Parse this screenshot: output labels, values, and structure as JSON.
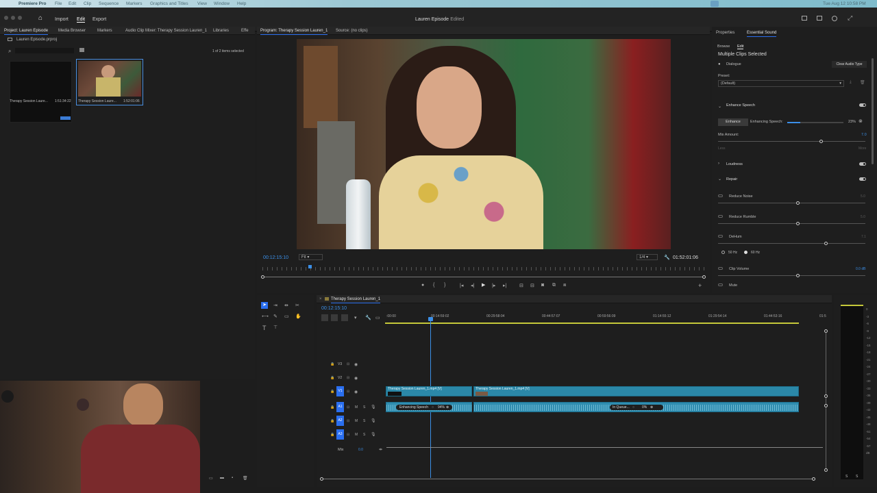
{
  "os_bar": {
    "app": "Premiere Pro",
    "menus": [
      "File",
      "Edit",
      "Clip",
      "Sequence",
      "Markers",
      "Graphics and Titles",
      "View",
      "Window",
      "Help"
    ],
    "clock": "Tue Aug 12  10:58 PM"
  },
  "header": {
    "nav": {
      "import": "Import",
      "edit": "Edit",
      "export": "Export"
    },
    "title": "Lauren Episode",
    "title_status": "- Edited"
  },
  "project": {
    "tabs": [
      "Project: Lauren Episode",
      "Media Browser",
      "Markers",
      "Audio Clip Mixer: Therapy Session Lauren_1",
      "Libraries",
      "Effe"
    ],
    "file": "Lauren Episode.prproj",
    "count": "1 of 2 items selected",
    "items": [
      {
        "name": "Therapy Session Laure...",
        "dur": "1:51:34:22"
      },
      {
        "name": "Therapy Session Laure...",
        "dur": "1:52:01:06"
      }
    ]
  },
  "program": {
    "tab": "Program: Therapy Session Lauren_1",
    "source_tab": "Source: (no clips)",
    "timecode": "00:12:15:10",
    "fit": "Fit",
    "res": "1/4",
    "duration": "01:52:01:06"
  },
  "essential_sound": {
    "tabs": [
      "Properties",
      "Essential Sound"
    ],
    "subtabs": [
      "Browse",
      "Edit"
    ],
    "heading": "Multiple Clips Selected",
    "type": "Dialogue",
    "clear_btn": "Clear Audio Type",
    "preset_label": "Preset:",
    "preset": "(Default)",
    "enhance_section": "Enhance Speech",
    "enhance_btn": "Enhance",
    "enhancing_label": "Enhancing Speech:",
    "enhancing_pct": "23%",
    "mix_label": "Mix Amount:",
    "mix_val": "7.0",
    "mix_less": "Less",
    "mix_more": "More",
    "loudness": "Loudness",
    "repair": "Repair",
    "reduce_noise": "Reduce Noise",
    "reduce_noise_val": "5.0",
    "reduce_rumble": "Reduce Rumble",
    "reduce_rumble_val": "5.0",
    "dehum": "DeHum",
    "dehum_val": "7.1",
    "hz50": "50 Hz",
    "hz60": "60 Hz",
    "clip_volume": "Clip Volume",
    "clip_volume_val": "0.0 dB",
    "mute": "Mute",
    "enhancing_progress": 0.23
  },
  "timeline": {
    "tab": "Therapy Session Lauren_1",
    "timecode": "00:12:15:10",
    "ruler": [
      ":00:00",
      "00:14:59:02",
      "00:29:58:04",
      "00:44:57:07",
      "00:59:56:09",
      "01:14:55:12",
      "01:29:54:14",
      "01:44:53:16",
      "01:5"
    ],
    "tracks": [
      "V3",
      "V2",
      "V1",
      "A1",
      "A2",
      "A3"
    ],
    "mix": "Mix",
    "mix_val": "0.0",
    "clip1": "Therapy Session Lauren_1.mp4 [V]",
    "clip2": "Therapy Session Lauren_1.mp4 [V]",
    "badge1": "Enhancing Speech",
    "badge1_pct": "94%",
    "badge2": "In Queue...",
    "badge2_pct": "0%"
  },
  "meter": {
    "labels": [
      "0",
      "-3",
      "-6",
      "-9",
      "-12",
      "-15",
      "-18",
      "-21",
      "-24",
      "-27",
      "-30",
      "-33",
      "-36",
      "-39",
      "-42",
      "-45",
      "-48",
      "-51",
      "-54",
      "-57",
      "dB"
    ],
    "foot": [
      "S",
      "S"
    ]
  }
}
